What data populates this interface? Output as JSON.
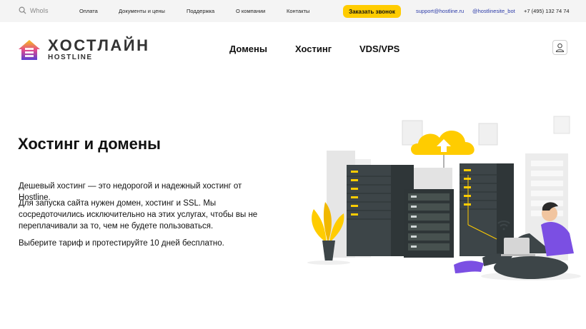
{
  "topbar": {
    "whois_placeholder": "WhoIs",
    "links": [
      "Оплата",
      "Документы и цены",
      "Поддержка",
      "О компании",
      "Контакты"
    ],
    "call_button": "Заказать звонок",
    "email": "support@hostline.ru",
    "telegram": "@hostlinesite_bot",
    "phone": "+7 (495) 132 74 74"
  },
  "header": {
    "logo_main": "ХОСТЛАЙН",
    "logo_sub": "HOSTLINE",
    "nav": [
      "Домены",
      "Хостинг",
      "VDS/VPS"
    ]
  },
  "hero": {
    "title": "Хостинг и домены",
    "paragraphs": [
      "Дешевый хостинг — это недорогой и надежный хостинг от Hostline.",
      "Для запуска сайта нужен домен, хостинг и SSL. Мы сосредоточились исключительно на этих услугах, чтобы вы не переплачивали за то, чем не будете пользоваться.",
      "Выберите тариф и протестируйте 10 дней бесплатно."
    ]
  },
  "colors": {
    "accent": "#ffcc00",
    "link": "#2b3aa8",
    "topbar_bg": "#f4f4f4"
  },
  "icons": [
    "search-icon",
    "user-icon",
    "cloud-upload-icon"
  ]
}
